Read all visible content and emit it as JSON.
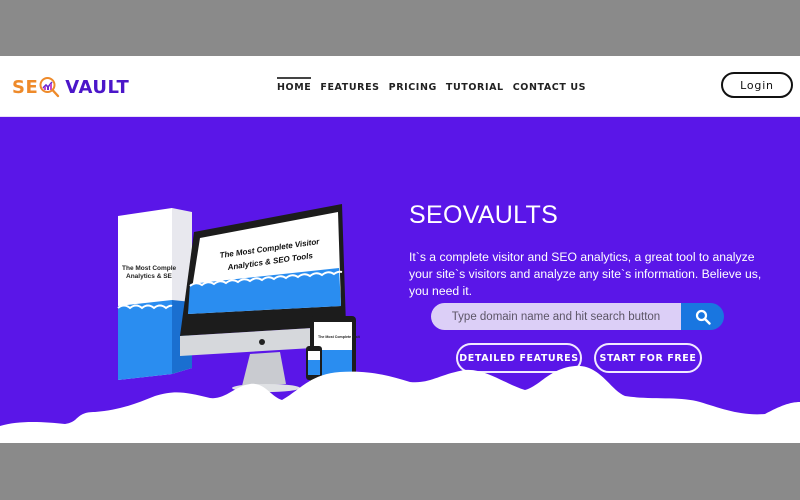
{
  "header": {
    "logo": {
      "part1": "SE",
      "part2": "VAULT",
      "icon": "magnifier-chart-icon"
    },
    "nav": [
      {
        "label": "HOME",
        "active": true
      },
      {
        "label": "FEATURES",
        "active": false
      },
      {
        "label": "PRICING",
        "active": false
      },
      {
        "label": "TUTORIAL",
        "active": false
      },
      {
        "label": "CONTACT US",
        "active": false
      }
    ],
    "login_label": "Login"
  },
  "hero": {
    "title": "SEOVAULTS",
    "description": "It`s a complete visitor and SEO analytics, a great tool to analyze your site`s visitors and analyze any site`s information. Believe us, you need it.",
    "search": {
      "value": "",
      "placeholder": "Type domain name and hit search button",
      "button_icon": "search-icon"
    },
    "buttons": {
      "features_label": "DETAILED FEATURES",
      "start_label": "START FOR FREE"
    },
    "product_image": {
      "box_text": "The Most Complete Visitor Analytics & SEO Tools",
      "monitor_text_line1": "The Most Complete Visitor",
      "monitor_text_line2": "Analytics & SEO Tools"
    }
  },
  "colors": {
    "hero_bg": "#5a16e8",
    "logo_orange": "#ee8a2a",
    "logo_purple": "#4b16c9",
    "search_button": "#1976e0",
    "search_field": "#dccff7"
  }
}
